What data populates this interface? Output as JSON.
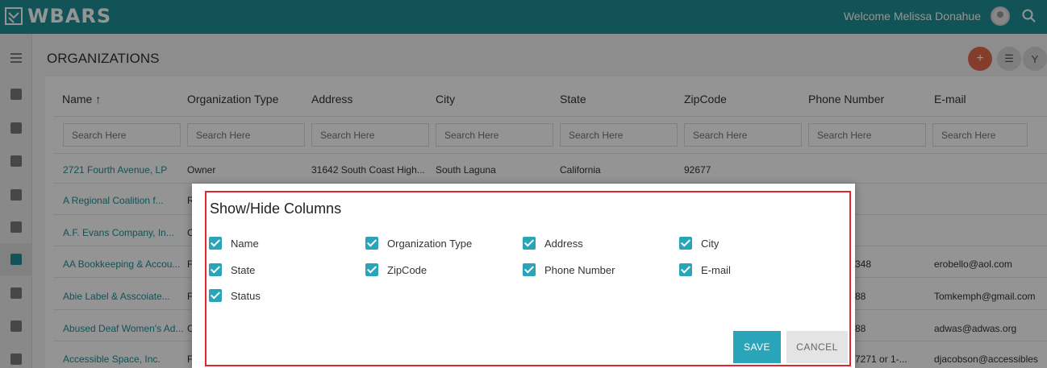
{
  "app": {
    "logo_text": "WBARS",
    "welcome_text": "Welcome Melissa Donahue"
  },
  "page": {
    "title": "ORGANIZATIONS"
  },
  "table": {
    "columns": [
      "Name ↑",
      "Organization Type",
      "Address",
      "City",
      "State",
      "ZipCode",
      "Phone Number",
      "E-mail"
    ],
    "search_placeholder": "Search Here",
    "rows": [
      {
        "name": "2721 Fourth Avenue, LP",
        "type": "Owner",
        "address": "31642 South Coast High...",
        "city": "South Laguna",
        "state": "California",
        "zip": "92677",
        "phone": "",
        "email": ""
      },
      {
        "name": "A Regional Coalition f...",
        "type": "R",
        "address": "",
        "city": "",
        "state": "",
        "zip": "",
        "phone": "",
        "email": ""
      },
      {
        "name": "A.F. Evans Company, In...",
        "type": "C",
        "address": "",
        "city": "",
        "state": "",
        "zip": "",
        "phone": "",
        "email": ""
      },
      {
        "name": "AA Bookkeeping & Accou...",
        "type": "F",
        "address": "",
        "city": "",
        "state": "",
        "zip": "",
        "phone": "348",
        "email": "erobello@aol.com"
      },
      {
        "name": "Abie Label & Asscoiate...",
        "type": "F",
        "address": "",
        "city": "",
        "state": "",
        "zip": "",
        "phone": "88",
        "email": "Tomkemph@gmail.com"
      },
      {
        "name": "Abused Deaf Women's Ad...",
        "type": "C",
        "address": "",
        "city": "",
        "state": "",
        "zip": "",
        "phone": "88",
        "email": "adwas@adwas.org"
      },
      {
        "name": "Accessible Space, Inc.",
        "type": "F",
        "address": "",
        "city": "",
        "state": "",
        "zip": "",
        "phone": "7271 or 1-...",
        "email": "djacobson@accessibles"
      }
    ]
  },
  "modal": {
    "title": "Show/Hide Columns",
    "options": [
      {
        "label": "Name",
        "checked": true
      },
      {
        "label": "Organization Type",
        "checked": true
      },
      {
        "label": "Address",
        "checked": true
      },
      {
        "label": "City",
        "checked": true
      },
      {
        "label": "State",
        "checked": true
      },
      {
        "label": "ZipCode",
        "checked": true
      },
      {
        "label": "Phone Number",
        "checked": true
      },
      {
        "label": "E-mail",
        "checked": true
      },
      {
        "label": "Status",
        "checked": true
      }
    ],
    "save_label": "SAVE",
    "cancel_label": "CANCEL"
  },
  "icons": {
    "search": "search-icon",
    "menu": "menu-icon",
    "add": "plus-icon",
    "columns": "columns-icon",
    "filter": "filter-icon"
  },
  "colors": {
    "brand": "#1e8f97",
    "accent_add": "#e56a4a",
    "checkbox": "#2aa4b8",
    "highlight_border": "#e0262f"
  }
}
